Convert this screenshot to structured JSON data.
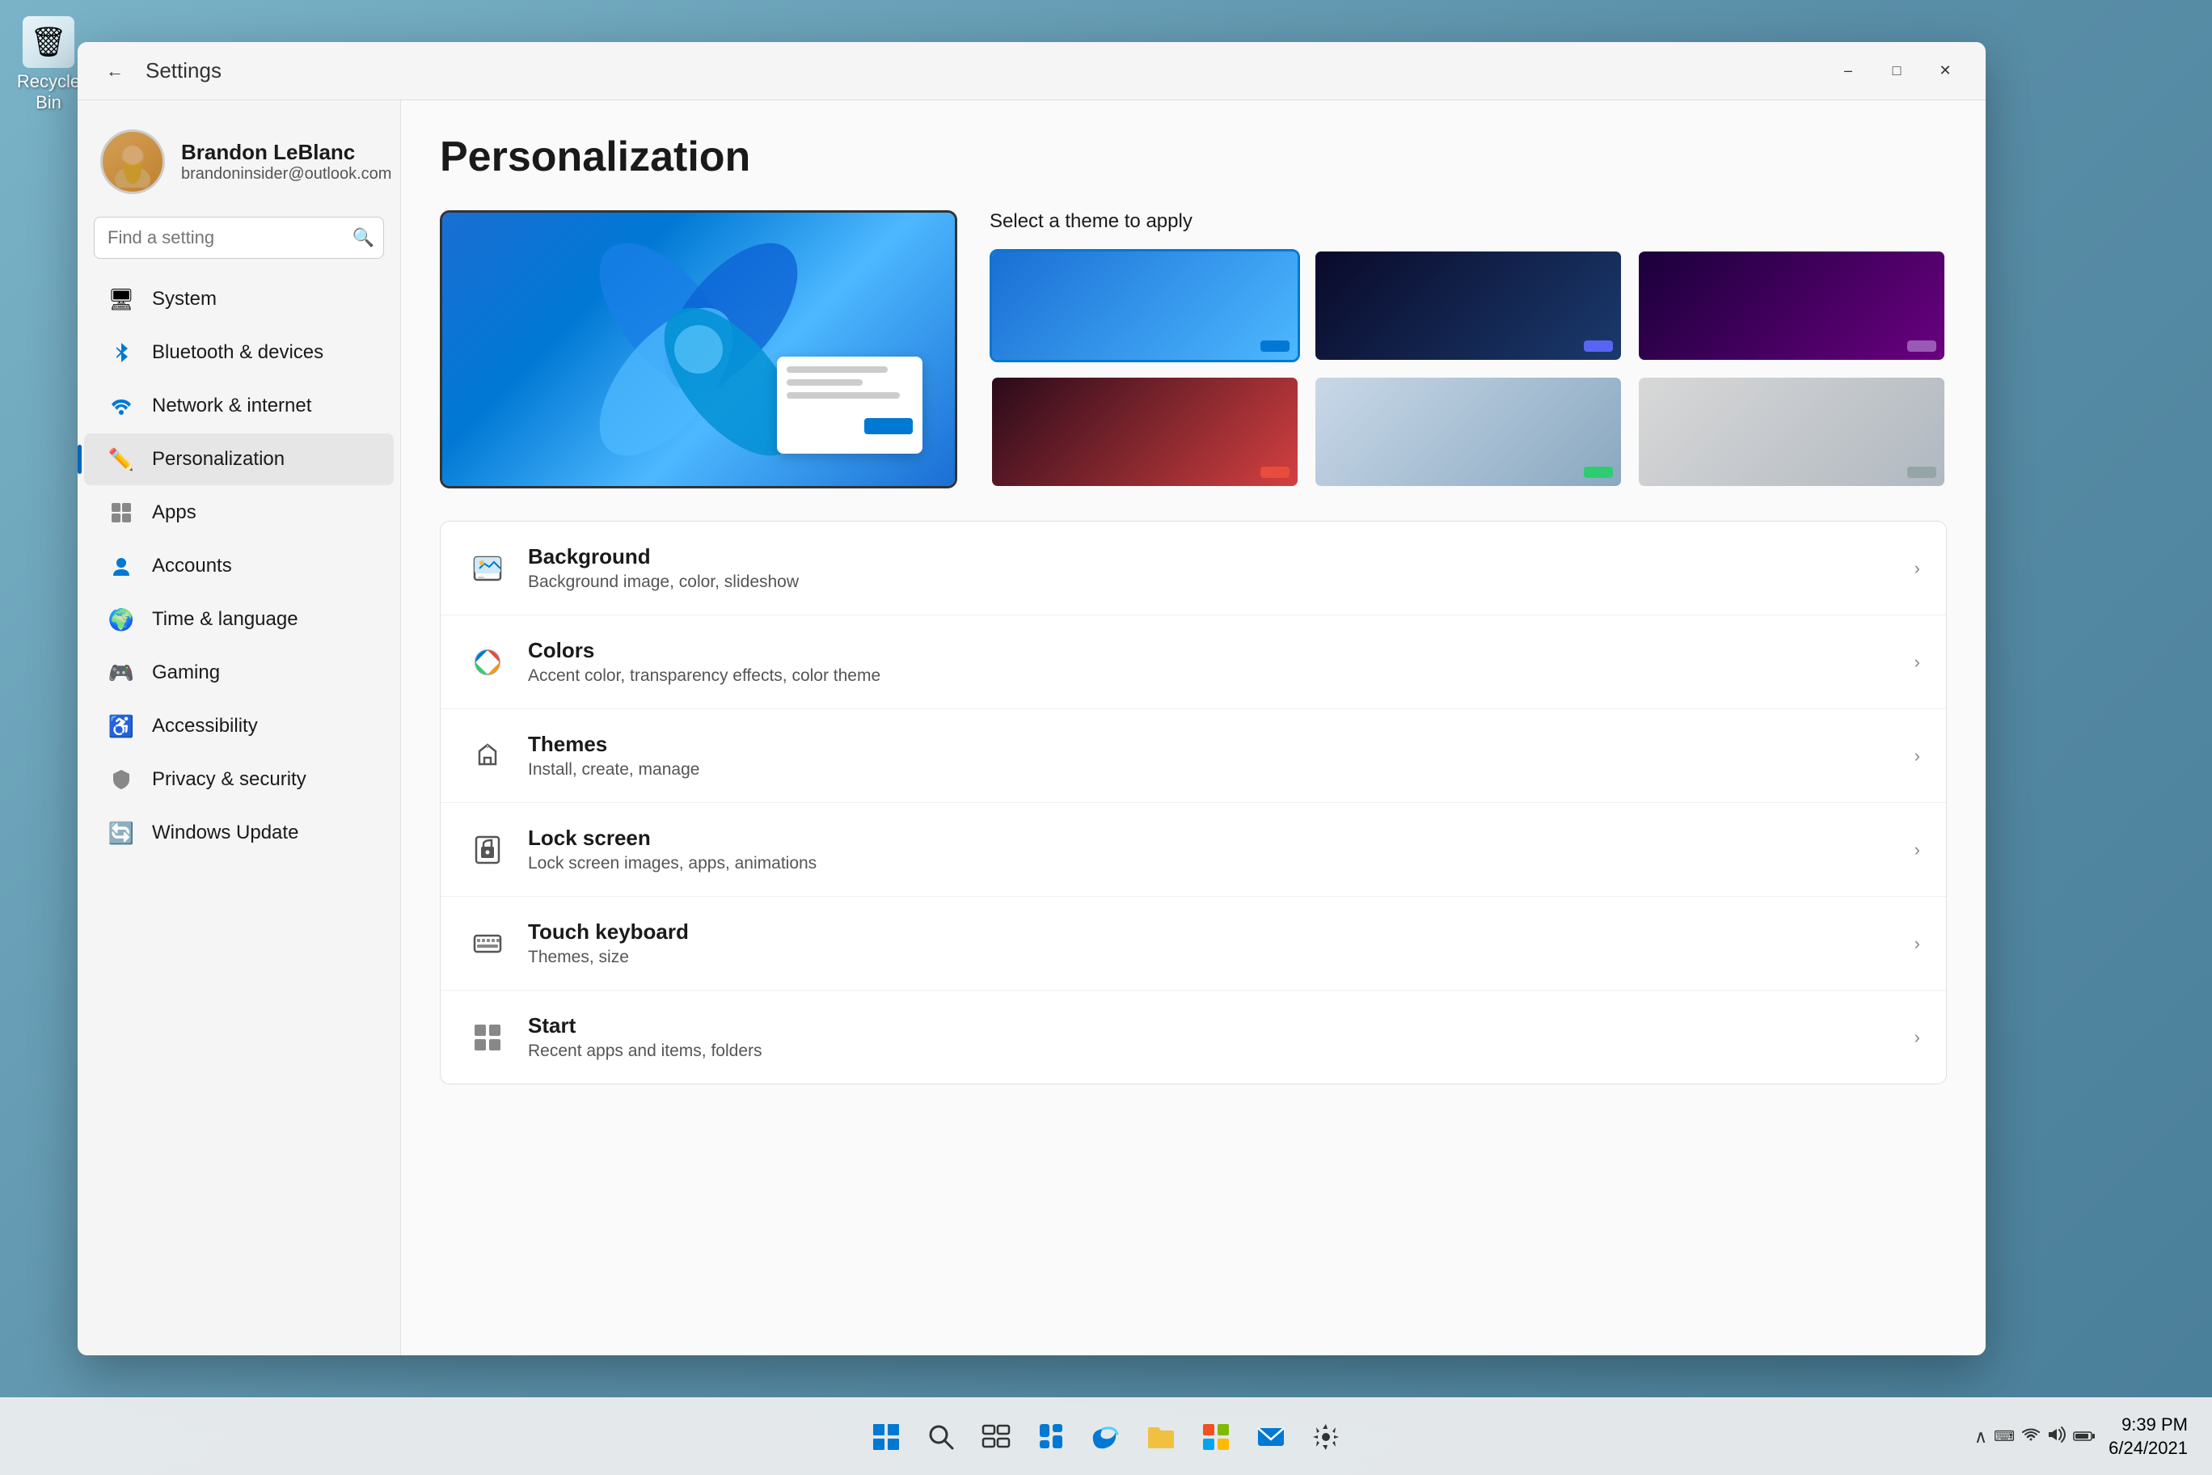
{
  "desktop": {
    "recycle_bin": {
      "label": "Recycle Bin",
      "icon": "🗑"
    }
  },
  "taskbar": {
    "clock": {
      "time": "9:39 PM",
      "date": "6/24/2021"
    },
    "icons": [
      {
        "name": "start-icon",
        "symbol": "⊞",
        "label": "Start"
      },
      {
        "name": "search-taskbar-icon",
        "symbol": "🔍",
        "label": "Search"
      },
      {
        "name": "taskview-icon",
        "symbol": "⧉",
        "label": "Task View"
      },
      {
        "name": "widgets-icon",
        "symbol": "▦",
        "label": "Widgets"
      },
      {
        "name": "edge-icon",
        "symbol": "🌐",
        "label": "Edge"
      },
      {
        "name": "explorer-icon",
        "symbol": "📁",
        "label": "File Explorer"
      },
      {
        "name": "store-icon",
        "symbol": "🏪",
        "label": "Microsoft Store"
      },
      {
        "name": "mail-icon",
        "symbol": "✉",
        "label": "Mail"
      },
      {
        "name": "settings-taskbar-icon",
        "symbol": "⚙",
        "label": "Settings"
      }
    ]
  },
  "window": {
    "title": "Settings",
    "back_label": "←",
    "minimize_label": "–",
    "maximize_label": "□",
    "close_label": "✕"
  },
  "sidebar": {
    "user": {
      "name": "Brandon LeBlanc",
      "email": "brandoninsider@outlook.com"
    },
    "search": {
      "placeholder": "Find a setting"
    },
    "nav_items": [
      {
        "id": "system",
        "label": "System",
        "icon": "🖥",
        "active": false
      },
      {
        "id": "bluetooth",
        "label": "Bluetooth & devices",
        "icon": "🔵",
        "active": false
      },
      {
        "id": "network",
        "label": "Network & internet",
        "icon": "🌐",
        "active": false
      },
      {
        "id": "personalization",
        "label": "Personalization",
        "icon": "✏️",
        "active": true
      },
      {
        "id": "apps",
        "label": "Apps",
        "icon": "📦",
        "active": false
      },
      {
        "id": "accounts",
        "label": "Accounts",
        "icon": "👤",
        "active": false
      },
      {
        "id": "time",
        "label": "Time & language",
        "icon": "🌍",
        "active": false
      },
      {
        "id": "gaming",
        "label": "Gaming",
        "icon": "🎮",
        "active": false
      },
      {
        "id": "accessibility",
        "label": "Accessibility",
        "icon": "♿",
        "active": false
      },
      {
        "id": "privacy",
        "label": "Privacy & security",
        "icon": "🛡",
        "active": false
      },
      {
        "id": "update",
        "label": "Windows Update",
        "icon": "🔄",
        "active": false
      }
    ]
  },
  "main": {
    "title": "Personalization",
    "theme_section": {
      "select_label": "Select a theme to apply",
      "themes": [
        {
          "id": 1,
          "class": "theme-1",
          "accent": "#0078d4",
          "selected": true
        },
        {
          "id": 2,
          "class": "theme-2",
          "accent": "#5865f2",
          "selected": false
        },
        {
          "id": 3,
          "class": "theme-3",
          "accent": "#9b59b6",
          "selected": false
        },
        {
          "id": 4,
          "class": "theme-4",
          "accent": "#e74c3c",
          "selected": false
        },
        {
          "id": 5,
          "class": "theme-5",
          "accent": "#2ecc71",
          "selected": false
        },
        {
          "id": 6,
          "class": "theme-6",
          "accent": "#95a5a6",
          "selected": false
        }
      ]
    },
    "settings_rows": [
      {
        "id": "background",
        "icon": "🖼",
        "title": "Background",
        "subtitle": "Background image, color, slideshow"
      },
      {
        "id": "colors",
        "icon": "🎨",
        "title": "Colors",
        "subtitle": "Accent color, transparency effects, color theme"
      },
      {
        "id": "themes",
        "icon": "✏",
        "title": "Themes",
        "subtitle": "Install, create, manage"
      },
      {
        "id": "lock-screen",
        "icon": "🔒",
        "title": "Lock screen",
        "subtitle": "Lock screen images, apps, animations"
      },
      {
        "id": "touch-keyboard",
        "icon": "⌨",
        "title": "Touch keyboard",
        "subtitle": "Themes, size"
      },
      {
        "id": "start",
        "icon": "⊞",
        "title": "Start",
        "subtitle": "Recent apps and items, folders"
      }
    ]
  }
}
